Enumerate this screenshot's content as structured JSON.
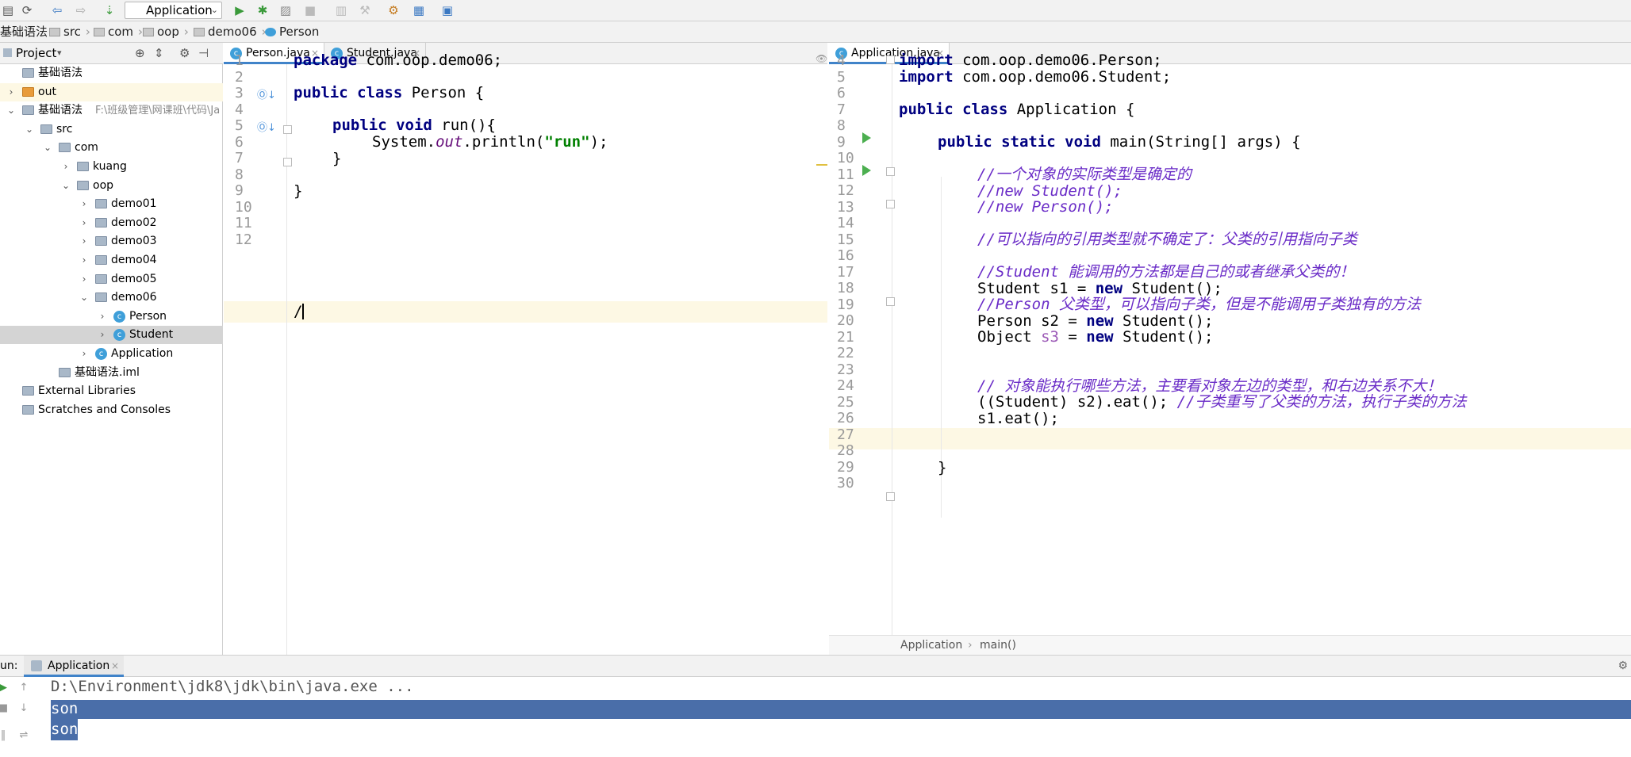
{
  "toolbar": {
    "run_config": "Application",
    "icons": [
      "save-icon",
      "sync-icon",
      "back-icon",
      "forward-icon",
      "build-icon",
      "run-icon",
      "debug-icon",
      "coverage-icon",
      "stop-icon",
      "attach-icon",
      "settings-icon",
      "project-structure-icon",
      "sdk-icon"
    ]
  },
  "breadcrumb": [
    "基础语法",
    "src",
    "com",
    "oop",
    "demo06",
    "Person"
  ],
  "project_panel": {
    "title": "Project",
    "tree": [
      {
        "label": "基础语法",
        "depth": 0
      },
      {
        "label": "out",
        "depth": 0
      },
      {
        "label": "基础语法",
        "hint": "F:\\班级管理\\网课班\\代码\\Ja",
        "depth": 0
      },
      {
        "label": "src",
        "depth": 1
      },
      {
        "label": "com",
        "depth": 2
      },
      {
        "label": "kuang",
        "depth": 3
      },
      {
        "label": "oop",
        "depth": 3
      },
      {
        "label": "demo01",
        "depth": 4
      },
      {
        "label": "demo02",
        "depth": 4
      },
      {
        "label": "demo03",
        "depth": 4
      },
      {
        "label": "demo04",
        "depth": 4
      },
      {
        "label": "demo05",
        "depth": 4
      },
      {
        "label": "demo06",
        "depth": 4
      },
      {
        "label": "Person",
        "depth": 5
      },
      {
        "label": "Student",
        "depth": 5
      },
      {
        "label": "Application",
        "depth": 4
      },
      {
        "label": "基础语法.iml",
        "depth": 2
      },
      {
        "label": "External Libraries",
        "depth": 0
      },
      {
        "label": "Scratches and Consoles",
        "depth": 0
      }
    ]
  },
  "left_editor": {
    "tabs": [
      "Person.java",
      "Student.java"
    ],
    "line_numbers": [
      "1",
      "2",
      "3",
      "4",
      "5",
      "6",
      "7",
      "8",
      "9",
      "10",
      "11",
      "12"
    ],
    "lines": {
      "l1_kw": "package",
      "l1_rest": " com.oop.demo06;",
      "l3_kw": "public class",
      "l3_rest": " Person {",
      "l5_kw": "public void",
      "l5_rest": " run(){",
      "l6_a": "System.",
      "l6_out": "out",
      "l6_b": ".println(",
      "l6_str": "\"run\"",
      "l6_c": ");",
      "l7": "}",
      "l9": "}",
      "l12": "/"
    }
  },
  "right_editor": {
    "tabs": [
      "Application.java"
    ],
    "line_numbers": [
      "4",
      "5",
      "6",
      "7",
      "8",
      "9",
      "10",
      "11",
      "12",
      "13",
      "14",
      "15",
      "16",
      "17",
      "18",
      "19",
      "20",
      "21",
      "22",
      "23",
      "24",
      "25",
      "26",
      "27",
      "28",
      "29",
      "30"
    ],
    "lines": {
      "l4_kw": "import",
      "l4_rest": " com.oop.demo06.Person;",
      "l5_kw": "import",
      "l5_rest": " com.oop.demo06.Student;",
      "l7_kw": "public class",
      "l7_rest": " Application {",
      "l9_kw": "public static void",
      "l9_rest": " main(String[] args) {",
      "l11": "//一个对象的实际类型是确定的",
      "l12": "//new Student();",
      "l13": "//new Person();",
      "l15": "//可以指向的引用类型就不确定了：父类的引用指向子类",
      "l17": "//Student 能调用的方法都是自己的或者继承父类的！",
      "l18_a": "Student s1 = ",
      "l18_kw": "new",
      "l18_b": " Student();",
      "l19": "//Person 父类型，可以指向子类，但是不能调用子类独有的方法",
      "l20_a": "Person s2 = ",
      "l20_kw": "new",
      "l20_b": " Student();",
      "l21_a": "Object ",
      "l21_var": "s3",
      "l21_b": " = ",
      "l21_kw": "new",
      "l21_c": " Student();",
      "l24": "// 对象能执行哪些方法，主要看对象左边的类型，和右边关系不大！",
      "l25_a": "((Student) s2).eat(); ",
      "l25_cmt": "//子类重写了父类的方法，执行子类的方法",
      "l26": "s1.eat();",
      "l29": "}"
    },
    "breadcrumb": [
      "Application",
      "main()"
    ]
  },
  "run_panel": {
    "label": "un:",
    "tab": "Application",
    "output": [
      "D:\\Environment\\jdk8\\jdk\\bin\\java.exe ...",
      "son",
      "son"
    ]
  },
  "colors": {
    "keyword": "#000080",
    "comment": "#6a2cc7",
    "string": "#008000",
    "selection": "#4a6ea9",
    "caret_line": "#fdf8e4"
  }
}
